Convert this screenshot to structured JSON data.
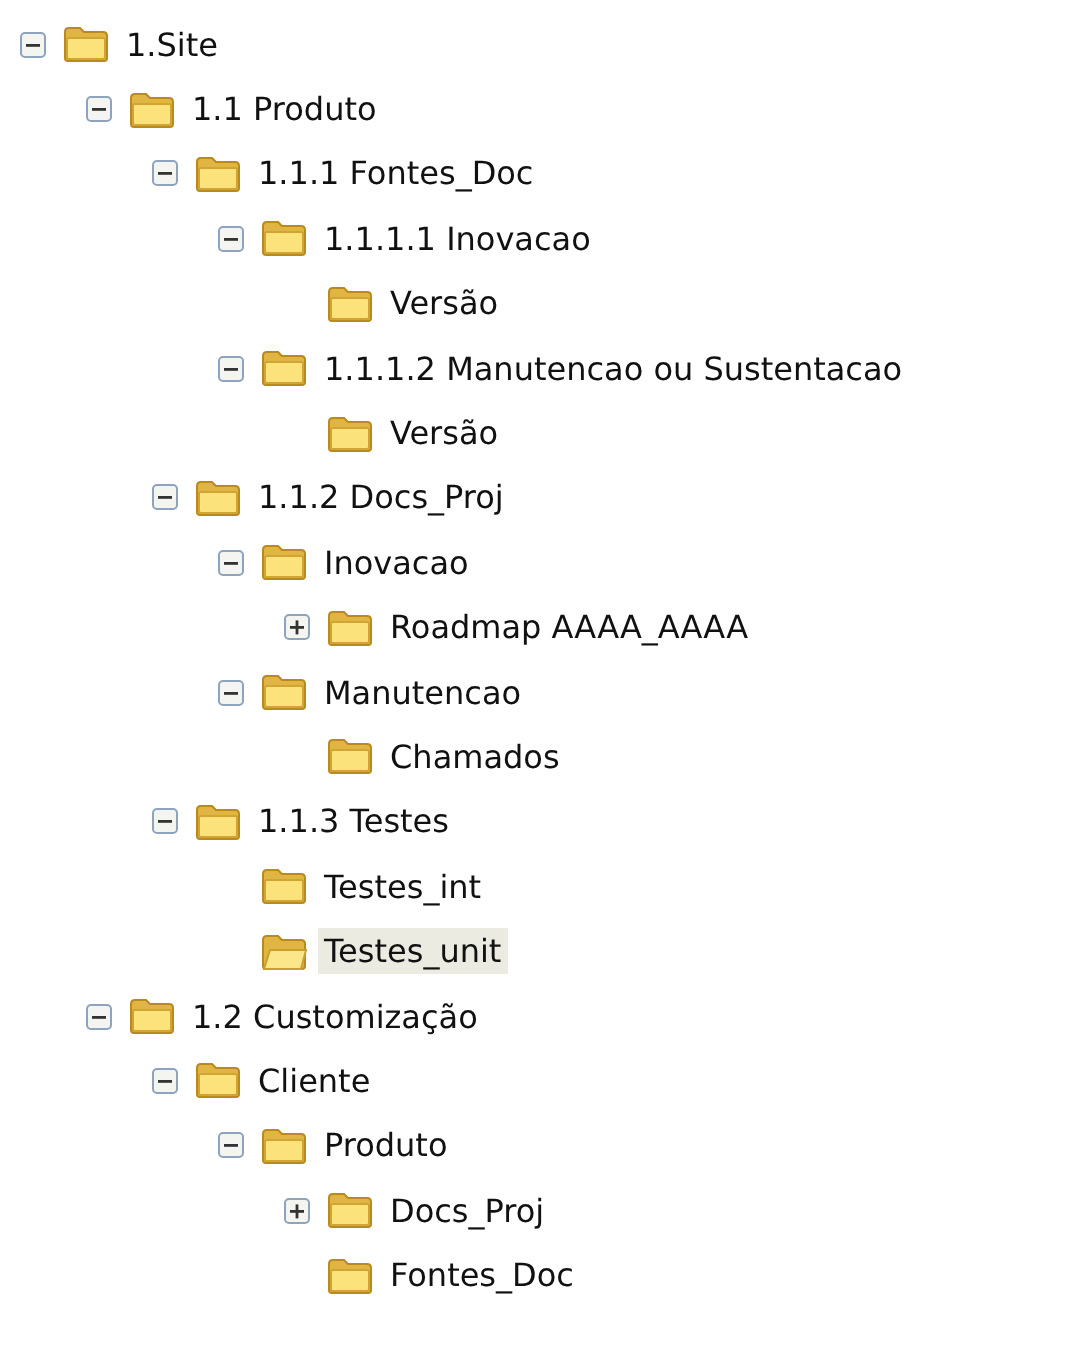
{
  "tree": [
    {
      "label": "1.Site",
      "expanded": true,
      "selected": false,
      "children": [
        {
          "label": "1.1 Produto",
          "expanded": true,
          "selected": false,
          "children": [
            {
              "label": "1.1.1 Fontes_Doc",
              "expanded": true,
              "selected": false,
              "children": [
                {
                  "label": "1.1.1.1 Inovacao",
                  "expanded": true,
                  "selected": false,
                  "children": [
                    {
                      "label": "Versão",
                      "selected": false
                    }
                  ]
                },
                {
                  "label": "1.1.1.2 Manutencao ou Sustentacao",
                  "expanded": true,
                  "selected": false,
                  "children": [
                    {
                      "label": "Versão",
                      "selected": false
                    }
                  ]
                }
              ]
            },
            {
              "label": "1.1.2 Docs_Proj",
              "expanded": true,
              "selected": false,
              "children": [
                {
                  "label": "Inovacao",
                  "expanded": true,
                  "selected": false,
                  "children": [
                    {
                      "label": "Roadmap AAAA_AAAA",
                      "expanded": false,
                      "selected": false
                    }
                  ]
                },
                {
                  "label": "Manutencao",
                  "expanded": true,
                  "selected": false,
                  "children": [
                    {
                      "label": "Chamados",
                      "selected": false
                    }
                  ]
                }
              ]
            },
            {
              "label": "1.1.3 Testes",
              "expanded": true,
              "selected": false,
              "children": [
                {
                  "label": "Testes_int",
                  "selected": false
                },
                {
                  "label": "Testes_unit",
                  "selected": true
                }
              ]
            }
          ]
        },
        {
          "label": "1.2 Customização",
          "expanded": true,
          "selected": false,
          "children": [
            {
              "label": "Cliente",
              "expanded": true,
              "selected": false,
              "children": [
                {
                  "label": "Produto",
                  "expanded": true,
                  "selected": false,
                  "children": [
                    {
                      "label": "Docs_Proj",
                      "expanded": false,
                      "selected": false
                    },
                    {
                      "label": "Fontes_Doc",
                      "selected": false
                    }
                  ]
                }
              ]
            }
          ]
        }
      ]
    }
  ]
}
